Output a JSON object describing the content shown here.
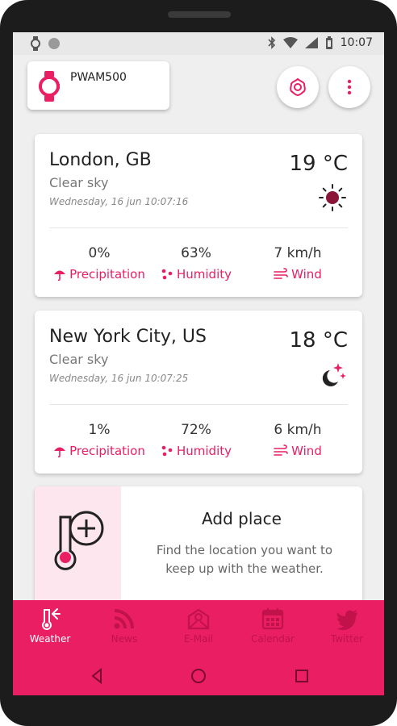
{
  "status_bar": {
    "time": "10:07",
    "left_icons": [
      "watch-icon",
      "circle-icon"
    ],
    "right_icons": [
      "bluetooth-icon",
      "wifi-icon",
      "signal-icon",
      "battery-icon"
    ]
  },
  "device": {
    "name": "PWAM500",
    "icon": "watch-icon"
  },
  "header_buttons": {
    "settings_icon": "flower-gear-icon",
    "menu_icon": "more-vert-icon"
  },
  "cities": [
    {
      "name": "London, GB",
      "description": "Clear sky",
      "datetime": "Wednesday, 16 jun 10:07:16",
      "temperature": "19 °C",
      "icon": "sun-icon",
      "precipitation": "0%",
      "humidity": "63%",
      "wind": "7 km/h"
    },
    {
      "name": "New York City, US",
      "description": "Clear sky",
      "datetime": "Wednesday, 16 jun 10:07:25",
      "temperature": "18 °C",
      "icon": "moon-stars-icon",
      "precipitation": "1%",
      "humidity": "72%",
      "wind": "6 km/h"
    }
  ],
  "labels": {
    "precipitation": "Precipitation",
    "humidity": "Humidity",
    "wind": "Wind"
  },
  "add_place": {
    "title": "Add place",
    "description": "Find the location you want to keep up with the weather."
  },
  "bottom_nav": [
    {
      "label": "Weather",
      "icon": "thermometer-icon",
      "active": true
    },
    {
      "label": "News",
      "icon": "rss-icon",
      "active": false
    },
    {
      "label": "E-Mail",
      "icon": "email-icon",
      "active": false
    },
    {
      "label": "Calendar",
      "icon": "calendar-icon",
      "active": false
    },
    {
      "label": "Twitter",
      "icon": "twitter-icon",
      "active": false
    }
  ],
  "colors": {
    "accent": "#e91e63",
    "accent_dark": "#c2124c",
    "sun": "#8b1538"
  }
}
